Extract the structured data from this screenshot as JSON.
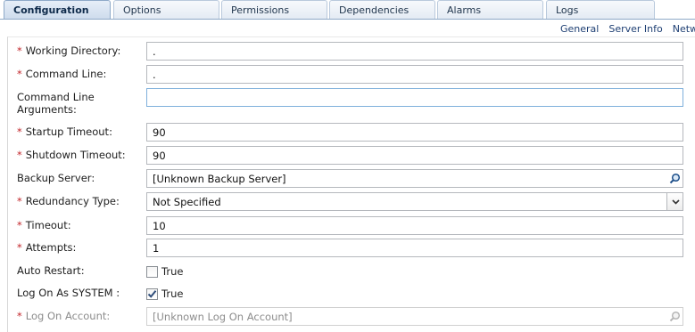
{
  "tabs": [
    {
      "label": "Configuration",
      "active": true
    },
    {
      "label": "Options"
    },
    {
      "label": "Permissions"
    },
    {
      "label": "Dependencies"
    },
    {
      "label": "Alarms"
    },
    {
      "label": "Logs"
    }
  ],
  "subnav": [
    "General",
    "Server Info",
    "Netw"
  ],
  "form": {
    "required_marker": "*",
    "working_directory": {
      "label": "Working Directory:",
      "value": "."
    },
    "command_line": {
      "label": "Command Line:",
      "value": "."
    },
    "command_line_arguments": {
      "label": "Command Line Arguments:",
      "value": ""
    },
    "startup_timeout": {
      "label": "Startup Timeout:",
      "value": "90"
    },
    "shutdown_timeout": {
      "label": "Shutdown Timeout:",
      "value": "90"
    },
    "backup_server": {
      "label": "Backup Server:",
      "value": "[Unknown Backup Server]"
    },
    "redundancy_type": {
      "label": "Redundancy Type:",
      "value": "Not Specified"
    },
    "timeout": {
      "label": "Timeout:",
      "value": "10"
    },
    "attempts": {
      "label": "Attempts:",
      "value": "1"
    },
    "auto_restart": {
      "label": "Auto Restart:",
      "option": "True",
      "checked": false
    },
    "log_on_as_system": {
      "label": "Log On As SYSTEM :",
      "option": "True",
      "checked": true
    },
    "log_on_account": {
      "label": "Log On Account:",
      "value": "[Unknown Log On Account]"
    }
  },
  "colors": {
    "required": "#c2262b",
    "accent": "#1e3f73",
    "tab_border": "#8ea9c8"
  }
}
